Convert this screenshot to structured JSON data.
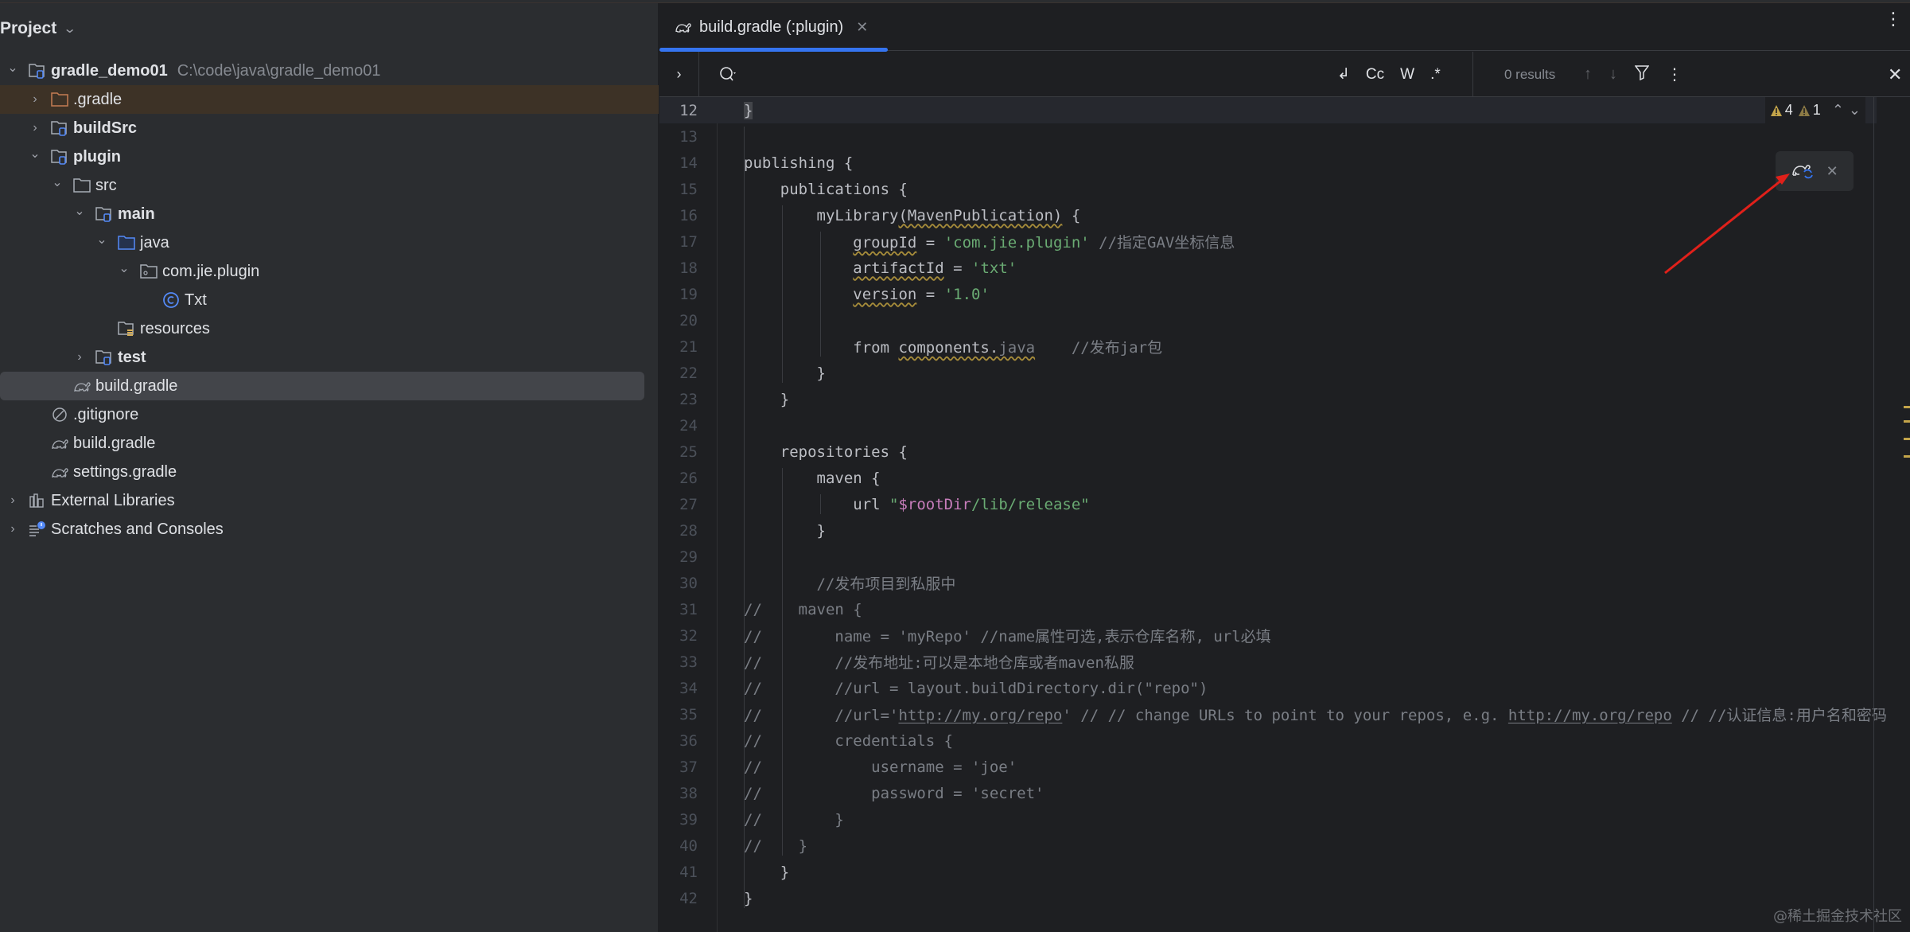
{
  "project": {
    "header_label": "Project",
    "tree": [
      {
        "label": "gradle_demo01",
        "path": "C:\\code\\java\\gradle_demo01",
        "icon": "module-folder-icon",
        "expanded": "open",
        "depth": 0,
        "bold": true
      },
      {
        "label": ".gradle",
        "icon": "excluded-folder-icon",
        "expanded": "closed",
        "depth": 1,
        "highlight": "orange"
      },
      {
        "label": "buildSrc",
        "icon": "module-folder-icon",
        "expanded": "closed",
        "depth": 1,
        "bold": true
      },
      {
        "label": "plugin",
        "icon": "module-folder-icon",
        "expanded": "open",
        "depth": 1,
        "bold": true
      },
      {
        "label": "src",
        "icon": "folder-icon",
        "expanded": "open",
        "depth": 2
      },
      {
        "label": "main",
        "icon": "module-folder-icon",
        "expanded": "open",
        "depth": 3,
        "bold": true
      },
      {
        "label": "java",
        "icon": "source-folder-icon",
        "expanded": "open",
        "depth": 4
      },
      {
        "label": "com.jie.plugin",
        "icon": "package-icon",
        "expanded": "open",
        "depth": 5
      },
      {
        "label": "Txt",
        "icon": "class-icon",
        "expanded": "none",
        "depth": 6
      },
      {
        "label": "resources",
        "icon": "resources-folder-icon",
        "expanded": "none",
        "depth": 4
      },
      {
        "label": "test",
        "icon": "module-folder-icon",
        "expanded": "closed",
        "depth": 3,
        "bold": true
      },
      {
        "label": "build.gradle",
        "icon": "gradle-icon",
        "expanded": "none",
        "depth": 2,
        "selected": true
      },
      {
        "label": ".gitignore",
        "icon": "ignore-icon",
        "expanded": "none",
        "depth": 1
      },
      {
        "label": "build.gradle",
        "icon": "gradle-icon",
        "expanded": "none",
        "depth": 1
      },
      {
        "label": "settings.gradle",
        "icon": "gradle-icon",
        "expanded": "none",
        "depth": 1
      },
      {
        "label": "External Libraries",
        "icon": "library-icon",
        "expanded": "closed",
        "depth": 0
      },
      {
        "label": "Scratches and Consoles",
        "icon": "scratches-icon",
        "expanded": "closed",
        "depth": 0
      }
    ]
  },
  "editor": {
    "tab": {
      "label": "build.gradle (:plugin)",
      "icon": "gradle-icon"
    },
    "find": {
      "placeholder": "",
      "options": [
        "↲",
        "Cc",
        "W",
        ".*"
      ],
      "results": "0 results"
    },
    "inspections": {
      "warnings": "4",
      "weak_warnings": "1"
    },
    "lines": [
      {
        "n": "12",
        "html": "<span class=\"tok-cursor\">}</span>",
        "current": true
      },
      {
        "n": "13",
        "html": ""
      },
      {
        "n": "14",
        "html": "publishing {"
      },
      {
        "n": "15",
        "html": "    publications {"
      },
      {
        "n": "16",
        "html": "        myLibrary<span class=\"tok-field\">(MavenPublication)</span> {"
      },
      {
        "n": "17",
        "html": "            <span class=\"tok-field\">groupId</span> = <span class=\"tok-str\">'com.jie.plugin'</span> <span class=\"tok-cmt\">//指定GAV坐标信息</span>"
      },
      {
        "n": "18",
        "html": "            <span class=\"tok-field\">artifactId</span> = <span class=\"tok-str\">'txt'</span>"
      },
      {
        "n": "19",
        "html": "            <span class=\"tok-field\">version</span> = <span class=\"tok-str\">'1.0'</span>"
      },
      {
        "n": "20",
        "html": ""
      },
      {
        "n": "21",
        "html": "            from <span class=\"tok-field\">components.<span class=\"tok-dim\">java</span></span>    <span class=\"tok-cmt\">//发布jar包</span>"
      },
      {
        "n": "22",
        "html": "        }"
      },
      {
        "n": "23",
        "html": "    }"
      },
      {
        "n": "24",
        "html": ""
      },
      {
        "n": "25",
        "html": "    repositories {"
      },
      {
        "n": "26",
        "html": "        maven {"
      },
      {
        "n": "27",
        "html": "            url <span class=\"tok-str\">\"</span><span class=\"tok-interp\">$rootDir</span><span class=\"tok-str\">/lib/release\"</span>"
      },
      {
        "n": "28",
        "html": "        }"
      },
      {
        "n": "29",
        "html": ""
      },
      {
        "n": "30",
        "html": "        <span class=\"tok-cmt\">//发布项目到私服中</span>"
      },
      {
        "n": "31",
        "html": "<span class=\"tok-cmt\">//    maven {</span>"
      },
      {
        "n": "32",
        "html": "<span class=\"tok-cmt\">//        name = 'myRepo' //name属性可选,表示仓库名称, url必填</span>"
      },
      {
        "n": "33",
        "html": "<span class=\"tok-cmt\">//        //发布地址:可以是本地仓库或者maven私服</span>"
      },
      {
        "n": "34",
        "html": "<span class=\"tok-cmt\">//        //url = layout.buildDirectory.dir(\"repo\")</span>"
      },
      {
        "n": "35",
        "html": "<span class=\"tok-cmt\">//        //url='<span class=\"tok-link\">http://my.org/repo</span>' // // change URLs to point to your repos, e.g. <span class=\"tok-link\">http://my.org/repo</span> // //认证信息:用户名和密码</span>"
      },
      {
        "n": "36",
        "html": "<span class=\"tok-cmt\">//        credentials {</span>"
      },
      {
        "n": "37",
        "html": "<span class=\"tok-cmt\">//            username = 'joe'</span>"
      },
      {
        "n": "38",
        "html": "<span class=\"tok-cmt\">//            password = 'secret'</span>"
      },
      {
        "n": "39",
        "html": "<span class=\"tok-cmt\">//        }</span>"
      },
      {
        "n": "40",
        "html": "<span class=\"tok-cmt\">//    }</span>"
      },
      {
        "n": "41",
        "html": "    }"
      },
      {
        "n": "42",
        "html": "}"
      }
    ]
  },
  "gradle_popup": {
    "icon": "gradle-sync-icon",
    "tooltip": "Load Gradle Changes"
  },
  "annotation": {
    "type": "red-arrow",
    "points_to": "gradle-sync-icon",
    "color": "#e0201a"
  },
  "watermark": "@稀土掘金技术社区",
  "colors": {
    "accent": "#3574f0",
    "string": "#6aab73",
    "comment": "#7a7e85",
    "interp": "#c77dbb",
    "warning": "#c4a54a"
  }
}
